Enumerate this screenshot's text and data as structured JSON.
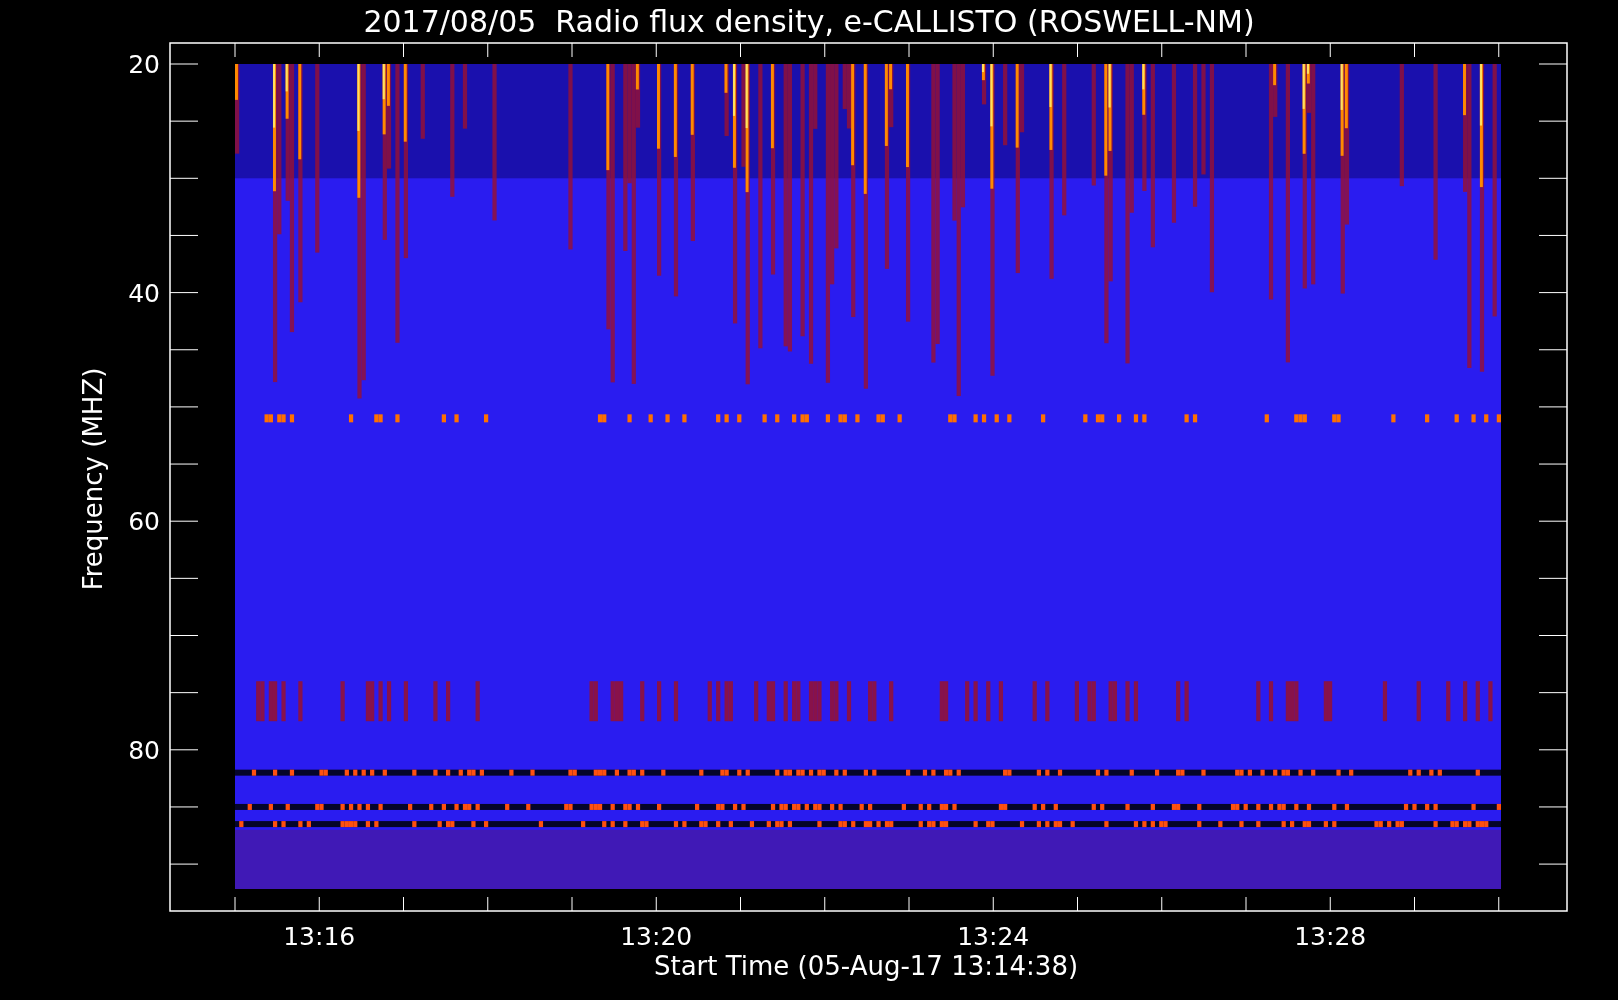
{
  "plot": {
    "title": "2017/08/05  Radio flux density, e-CALLISTO (ROSWELL-NM)",
    "xlabel": "Start Time (05-Aug-17 13:14:38)",
    "ylabel": "Frequency (MHZ)",
    "xtick_labels": [
      "13:16",
      "13:20",
      "13:24",
      "13:28"
    ],
    "ytick_labels": [
      "20",
      "40",
      "60",
      "80"
    ]
  }
}
